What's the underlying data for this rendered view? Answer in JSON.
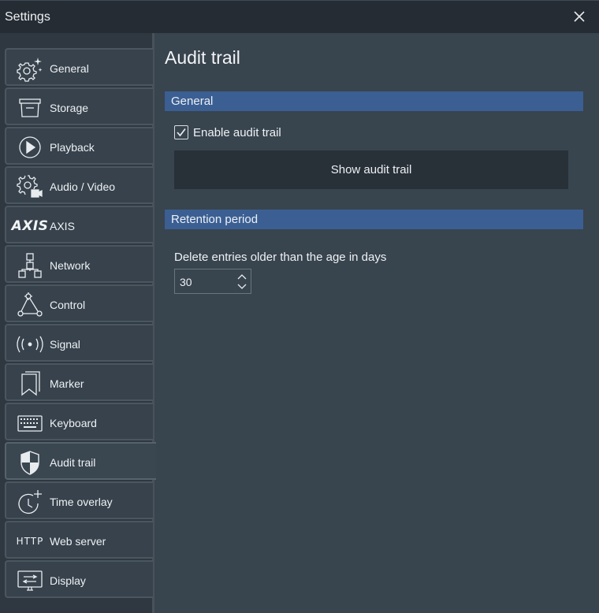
{
  "window": {
    "title": "Settings"
  },
  "sidebar": {
    "items": [
      {
        "label": "General",
        "icon": "gear-sparkle-icon"
      },
      {
        "label": "Storage",
        "icon": "storage-icon"
      },
      {
        "label": "Playback",
        "icon": "play-icon"
      },
      {
        "label": "Audio / Video",
        "icon": "gear-camera-icon"
      },
      {
        "label": "AXIS",
        "icon": "axis-logo",
        "icon_text": "AXIS"
      },
      {
        "label": "Network",
        "icon": "network-icon"
      },
      {
        "label": "Control",
        "icon": "control-icon"
      },
      {
        "label": "Signal",
        "icon": "signal-icon",
        "icon_text": "((·))"
      },
      {
        "label": "Marker",
        "icon": "bookmark-icon"
      },
      {
        "label": "Keyboard",
        "icon": "keyboard-icon"
      },
      {
        "label": "Audit trail",
        "icon": "shield-icon",
        "active": true
      },
      {
        "label": "Time overlay",
        "icon": "clock-plus-icon"
      },
      {
        "label": "Web server",
        "icon": "http-icon",
        "icon_text": "HTTP"
      },
      {
        "label": "Display",
        "icon": "display-icon"
      }
    ]
  },
  "main": {
    "title": "Audit trail",
    "general_section": {
      "header": "General",
      "enable_checkbox": {
        "label": "Enable audit trail",
        "checked": true
      },
      "show_button": "Show audit trail"
    },
    "retention_section": {
      "header": "Retention period",
      "field_label": "Delete entries older than the age in days",
      "days_value": "30"
    }
  },
  "colors": {
    "section_header": "#3b5f93",
    "main_bg": "#38444e",
    "sidebar_bg": "#2f3840",
    "titlebar_bg": "#252c33"
  }
}
